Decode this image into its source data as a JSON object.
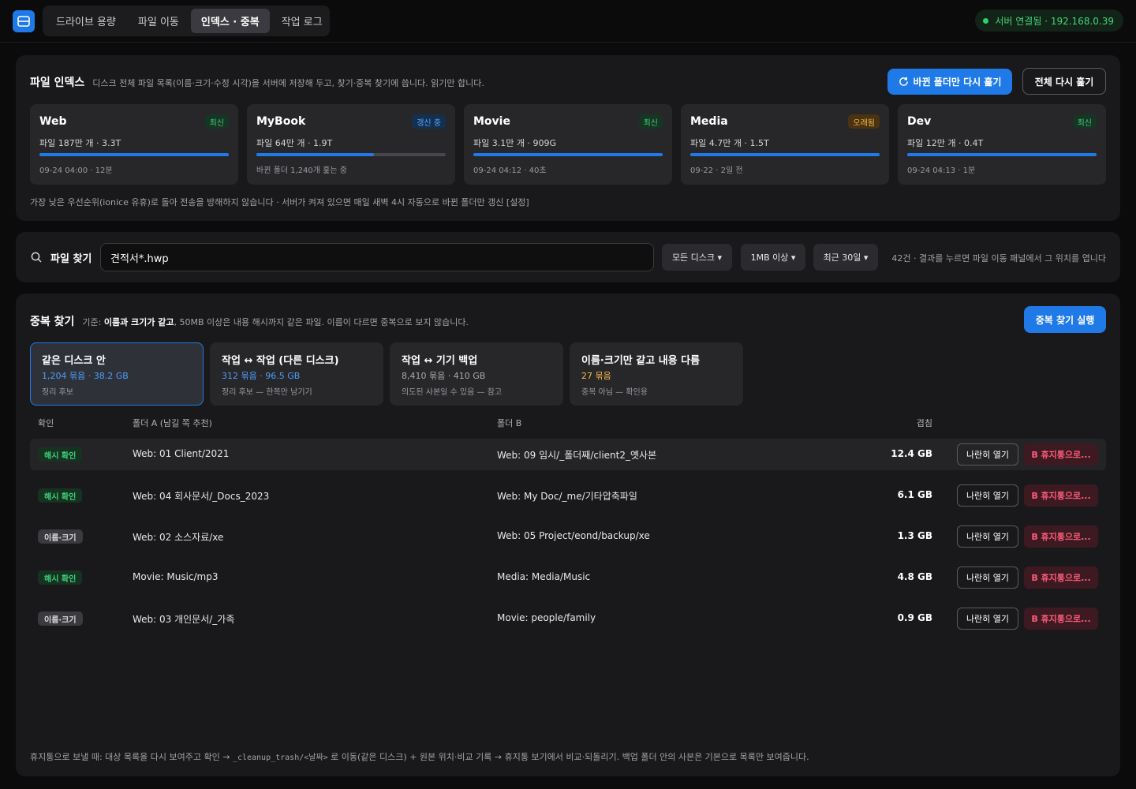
{
  "header": {
    "tabs": [
      {
        "label": "드라이브 용량",
        "active": false
      },
      {
        "label": "파일 이동",
        "active": false
      },
      {
        "label": "인덱스 · 중복",
        "active": true
      },
      {
        "label": "작업 로그",
        "active": false
      }
    ],
    "server_status": "서버 연결됨 · 192.168.0.39",
    "accent": "#1f7ae8"
  },
  "index": {
    "title": "파일 인덱스",
    "description": "디스크 전체 파일 목록(이름·크기·수정 시각)을 서버에 저장해 두고, 찾기·중복 찾기에 씁니다. 읽기만 합니다.",
    "refresh_changed_label": "바뀐 폴더만 다시 훑기",
    "refresh_all_label": "전체 다시 훑기",
    "disks": [
      {
        "name": "Web",
        "badge": "최신",
        "badge_type": "green",
        "info": "파일 187만 개 · 3.3T",
        "progress": 1.0,
        "sub": "09-24 04:00 · 12분"
      },
      {
        "name": "MyBook",
        "badge": "갱신 중",
        "badge_type": "blue",
        "info": "파일 64만 개 · 1.9T",
        "progress": 0.62,
        "sub": "바뀐 폴더 1,240개 훑는 중"
      },
      {
        "name": "Movie",
        "badge": "최신",
        "badge_type": "green",
        "info": "파일 3.1만 개 · 909G",
        "progress": 1.0,
        "sub": "09-24 04:12 · 40초"
      },
      {
        "name": "Media",
        "badge": "오래됨",
        "badge_type": "orange",
        "info": "파일 4.7만 개 · 1.5T",
        "progress": 1.0,
        "sub": "09-22 · 2일 전"
      },
      {
        "name": "Dev",
        "badge": "최신",
        "badge_type": "green",
        "info": "파일 12만 개 · 0.4T",
        "progress": 1.0,
        "sub": "09-24 04:13 · 1분"
      }
    ],
    "note": "가장 낮은 우선순위(ionice 유휴)로 돌아 전송을 방해하지 않습니다 · 서버가 켜져 있으면 매일 새벽 4시 자동으로 바뀐 폴더만 갱신 [설정]"
  },
  "search": {
    "title": "파일 찾기",
    "value": "견적서*.hwp",
    "filters": [
      "모든 디스크 ▾",
      "1MB 이상 ▾",
      "최근 30일 ▾"
    ],
    "result_text": "42건 · 결과를 누르면 파일 이동 패널에서 그 위치를 엽니다"
  },
  "duplicates": {
    "title": "중복 찾기",
    "criteria_prefix": "기준:",
    "criteria_bold": "이름과 크기가 같고",
    "criteria_suffix": ", 50MB 이상은 내용 해시까지 같은 파일. 이름이 다르면 중복으로 보지 않습니다.",
    "run_label": "중복 찾기 실행",
    "categories": [
      {
        "title": "같은 디스크 안",
        "count": "1,204 묶음 · 38.2 GB",
        "count_color": "#4f9cf9",
        "note": "정리 후보",
        "selected": true
      },
      {
        "title": "작업 ↔ 작업 (다른 디스크)",
        "count": "312 묶음 · 96.5 GB",
        "count_color": "#4f9cf9",
        "note": "정리 후보 — 한쪽만 남기기",
        "selected": false
      },
      {
        "title": "작업 ↔ 기기 백업",
        "count": "8,410 묶음 · 410 GB",
        "count_color": "#a8a8ae",
        "note": "의도된 사본일 수 있음 — 참고",
        "selected": false
      },
      {
        "title": "이름·크기만 같고 내용 다름",
        "count": "27 묶음",
        "count_color": "#f4b64c",
        "note": "중복 아님 — 확인용",
        "selected": false
      }
    ],
    "columns": {
      "check": "확인",
      "folder_a": "폴더 A (남길 쪽 추천)",
      "folder_b": "폴더 B",
      "overlap": "겹침"
    },
    "rows": [
      {
        "status": "해시 확인",
        "status_type": "hash",
        "a": "Web: 01 Client/2021",
        "b": "Web: 09 임시/_폴더째/client2_옛사본",
        "size": "12.4 GB"
      },
      {
        "status": "해시 확인",
        "status_type": "hash",
        "a": "Web: 04 회사문서/_Docs_2023",
        "b": "Web: My Doc/_me/기타압축파일",
        "size": "6.1 GB"
      },
      {
        "status": "이름·크기",
        "status_type": "name",
        "a": "Web: 02 소스자료/xe",
        "b": "Web: 05 Project/eond/backup/xe",
        "size": "1.3 GB"
      },
      {
        "status": "해시 확인",
        "status_type": "hash",
        "a": "Movie: Music/mp3",
        "b": "Media: Media/Music",
        "size": "4.8 GB"
      },
      {
        "status": "이름·크기",
        "status_type": "name",
        "a": "Web: 03 개인문서/_가족",
        "b": "Movie: people/family",
        "size": "0.9 GB"
      }
    ],
    "side_label": "나란히 열기",
    "trash_label": "B 휴지통으로...",
    "footnote_prefix": "휴지통으로 보낼 때: 대상 목록을 다시 보여주고 확인 → ",
    "footnote_path": "_cleanup_trash/<날짜>",
    "footnote_suffix": " 로 이동(같은 디스크) + 원본 위치·비교 기록 → 휴지통 보기에서 비교·되돌리기. 백업 폴더 안의 사본은 기본으로 목록만 보여줍니다."
  }
}
